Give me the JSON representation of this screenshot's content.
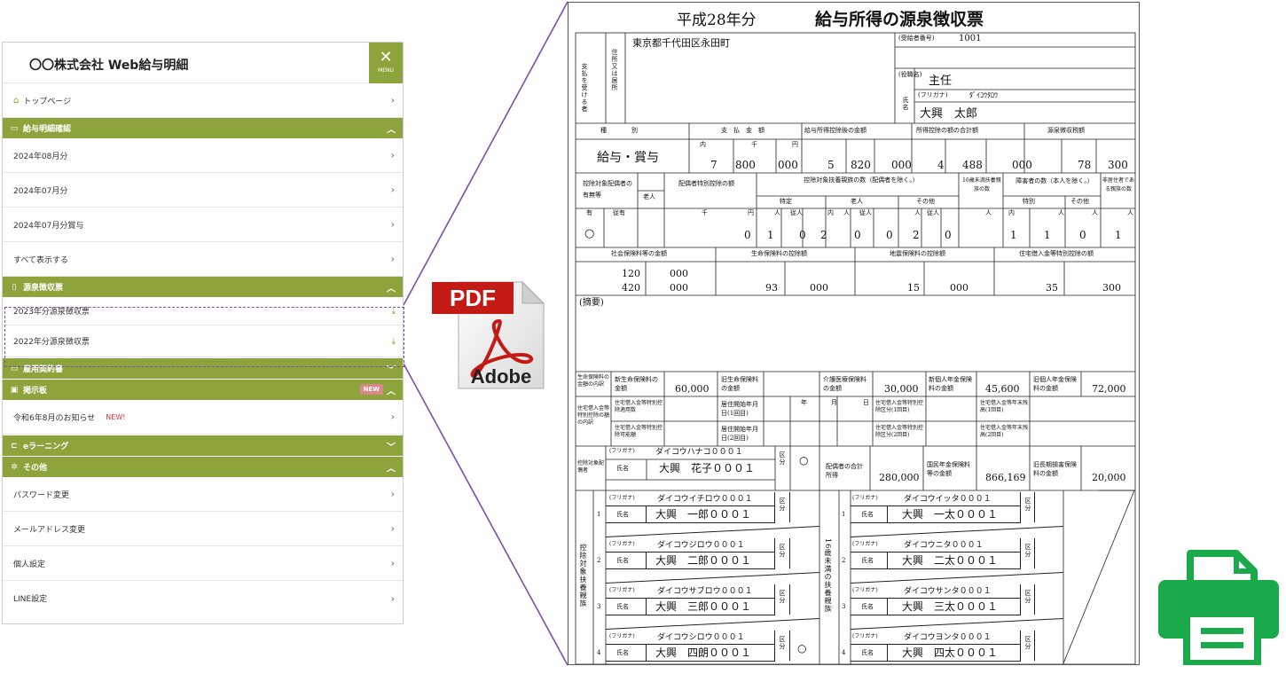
{
  "sidebar": {
    "title": "〇〇株式会社 Web給与明細",
    "menu_label": "MENU",
    "close_symbol": "✕",
    "top_page": "トップページ",
    "sections": {
      "payslip": "給与明細確認",
      "withholding": "源泉徴収票",
      "contract": "雇用契約書",
      "board": "掲示板",
      "elearning": "eラーニング",
      "other": "その他"
    },
    "payslip_items": [
      "2024年08月分",
      "2024年07月分",
      "2024年07月分賞与",
      "すべて表示する"
    ],
    "withholding_items": [
      "2023年分源泉徴収票",
      "2022年分源泉徴収票"
    ],
    "board_badge": "NEW",
    "board_item": "令和6年8月のお知らせ",
    "board_item_new": "NEW!",
    "other_items": [
      "パスワード変更",
      "メールアドレス変更",
      "個人設定",
      "LINE設定"
    ],
    "accent_color": "#8da33c",
    "dash_color": "#7b4fa8"
  },
  "pdf": {
    "label": "PDF",
    "brand": "Adobe",
    "red": "#c41a16"
  },
  "doc": {
    "year": "平成28年分",
    "title": "給与所得の源泉徴収票",
    "address": "東京都千代田区永田町",
    "recipient_no_label": "(受給者番号)",
    "recipient_no": "1001",
    "position_label": "(役職名)",
    "position": "主任",
    "furigana_label": "(フリガナ)",
    "furigana": "ﾀﾞｲｺｳﾀﾛｳ",
    "name_label": "氏名",
    "name": "大興　太郎",
    "payer_label": "支払を受ける者",
    "addr_label": "住所又は居所",
    "col_headers": [
      "種　　　　別",
      "支　払　金　額",
      "給与所得控除後の金額",
      "所得控除の額の合計額",
      "源泉徴収税額"
    ],
    "kind": "給与・賞与",
    "unit_labels": [
      "内",
      "千",
      "円"
    ],
    "pay_amount": [
      "7",
      "800",
      "000"
    ],
    "after_deduction": [
      "5",
      "820",
      "000"
    ],
    "deduction_total": [
      "4",
      "488",
      "000"
    ],
    "withheld_tax": [
      "78",
      "300"
    ],
    "r3_headers": [
      "控除対象配偶者の有無等",
      "老人",
      "配偶者特別控除の額",
      "控除対象扶養親族の数（配偶者を除く。）",
      "特定",
      "老人",
      "その他",
      "16歳未満扶養親族の数",
      "障害者の数（本人を除く。）",
      "特別",
      "その他",
      "非居住者である親族の数"
    ],
    "r4_units": [
      "有",
      "従有",
      "千",
      "円",
      "人",
      "従人",
      "内",
      "人",
      "従人",
      "人",
      "従人",
      "人",
      "内",
      "人",
      "人",
      "人"
    ],
    "r4_values": [
      "○",
      "0",
      "1",
      "0",
      "2",
      "0",
      "0",
      "2",
      "0",
      "1",
      "1",
      "0",
      "1"
    ],
    "r5_headers": [
      "社会保険料等の金額",
      "生命保険料の控除額",
      "地震保険料の控除額",
      "住宅借入金等特別控除の額"
    ],
    "social_ins": [
      "120",
      "000",
      "420",
      "000"
    ],
    "life_ins": [
      "93",
      "000"
    ],
    "quake_ins": [
      "15",
      "000"
    ],
    "housing": [
      "35",
      "300"
    ],
    "summary_label": "(摘要)",
    "life_detail_label": "生命保険料の金額の内訳",
    "life_new_label": "新生命保険料の金額",
    "life_new": "60,000",
    "life_old_label": "旧生命保険料の金額",
    "care_label": "介護医療保険料の金額",
    "care": "30,000",
    "pension_new_label": "新個人年金保険料の金額",
    "pension_new": "45,600",
    "pension_old_label": "旧個人年金保険料の金額",
    "pension_old": "72,000",
    "housing_detail_label": "住宅借入金等特別控除の額の内訳",
    "housing_labels": [
      "住宅借入金等特別控除適用数",
      "居住開始年月日(1回目)",
      "年",
      "月",
      "日",
      "住宅借入金等特別控除区分(1回目)",
      "住宅借入金等年末残高(1回目)",
      "住宅借入金等特別控除可能額",
      "居住開始年月日(2回目)",
      "住宅借入金等特別控除区分(2回目)",
      "住宅借入金等年末残高(2回目)"
    ],
    "spouse_label": "控除対象配偶者",
    "spouse_furigana": "ダイコウハナコ０００１",
    "spouse_name": "大興　花子０００１",
    "kubun": "区分",
    "spouse_income_label": "配偶者の合計所得",
    "spouse_income": "280,000",
    "national_pension_label": "国民年金保険料等の金額",
    "national_pension": "866,169",
    "old_longterm_label": "旧長期損害保険料の金額",
    "old_longterm": "20,000",
    "dependents_label": "控除対象扶養親族",
    "under16_label": "16歳未満の扶養親族",
    "dependents": [
      {
        "no": "1",
        "kana": "ダイコウイチロウ０００１",
        "name": "大興　一郎０００１",
        "mark": ""
      },
      {
        "no": "2",
        "kana": "ダイコウジロウ０００１",
        "name": "大興　二郎０００１",
        "mark": ""
      },
      {
        "no": "3",
        "kana": "ダイコウサブロウ０００１",
        "name": "大興　三郎０００１",
        "mark": ""
      },
      {
        "no": "4",
        "kana": "ダイコウシロウ０００１",
        "name": "大興　四朗０００１",
        "mark": "○"
      }
    ],
    "children": [
      {
        "no": "1",
        "kana": "ダイコウイッタ０００１",
        "name": "大興　一太０００１"
      },
      {
        "no": "2",
        "kana": "ダイコウニタ０００１",
        "name": "大興　二太０００１"
      },
      {
        "no": "3",
        "kana": "ダイコウサンタ０００１",
        "name": "大興　三太０００１"
      },
      {
        "no": "4",
        "kana": "ダイコウヨンタ０００１",
        "name": "大興　四太０００１"
      }
    ]
  },
  "printer": {
    "color": "#1aaa4a"
  }
}
